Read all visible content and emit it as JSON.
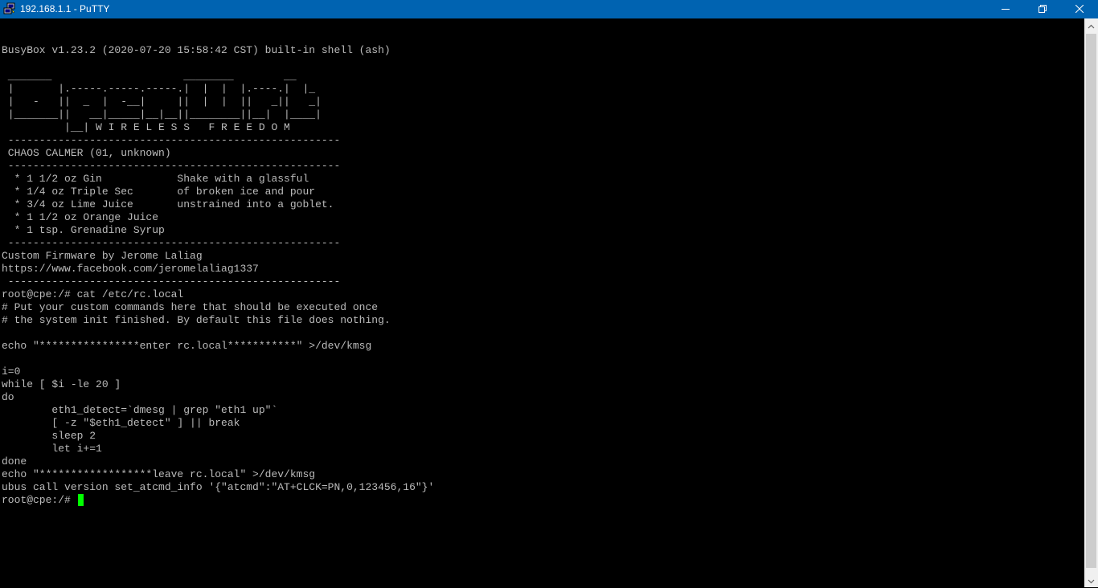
{
  "window": {
    "title": "192.168.1.1 - PuTTY",
    "icon": "putty-computers-icon",
    "controls": [
      "minimize-icon",
      "maximize-icon",
      "close-icon"
    ]
  },
  "colors": {
    "titlebar": "#0063b1",
    "terminal_bg": "#000000",
    "terminal_fg": "#bbbbbb",
    "cursor": "#00ff00"
  },
  "terminal": {
    "lines": [
      "BusyBox v1.23.2 (2020-07-20 15:58:42 CST) built-in shell (ash)",
      "",
      " _______                     ________        __",
      " |       |.-----.-----.-----.|  |  |  |.----.|  |_",
      " |   -   ||  _  |  -__|     ||  |  |  ||   _||   _|",
      " |_______||   __|_____|__|__||________||__|  |____|",
      "          |__| W I R E L E S S   F R E E D O M",
      " -----------------------------------------------------",
      " CHAOS CALMER (01, unknown)",
      " -----------------------------------------------------",
      "  * 1 1/2 oz Gin            Shake with a glassful",
      "  * 1/4 oz Triple Sec       of broken ice and pour",
      "  * 3/4 oz Lime Juice       unstrained into a goblet.",
      "  * 1 1/2 oz Orange Juice",
      "  * 1 tsp. Grenadine Syrup",
      " -----------------------------------------------------",
      "Custom Firmware by Jerome Laliag",
      "https://www.facebook.com/jeromelaliag1337",
      " -----------------------------------------------------",
      "root@cpe:/# cat /etc/rc.local",
      "# Put your custom commands here that should be executed once",
      "# the system init finished. By default this file does nothing.",
      "",
      "echo \"****************enter rc.local***********\" >/dev/kmsg",
      "",
      "i=0",
      "while [ $i -le 20 ]",
      "do",
      "        eth1_detect=`dmesg | grep \"eth1 up\"`",
      "        [ -z \"$eth1_detect\" ] || break",
      "        sleep 2",
      "        let i+=1",
      "done",
      "echo \"******************leave rc.local\" >/dev/kmsg",
      "ubus call version set_atcmd_info '{\"atcmd\":\"AT+CLCK=PN,0,123456,16\"}'"
    ],
    "prompt": "root@cpe:/# "
  }
}
